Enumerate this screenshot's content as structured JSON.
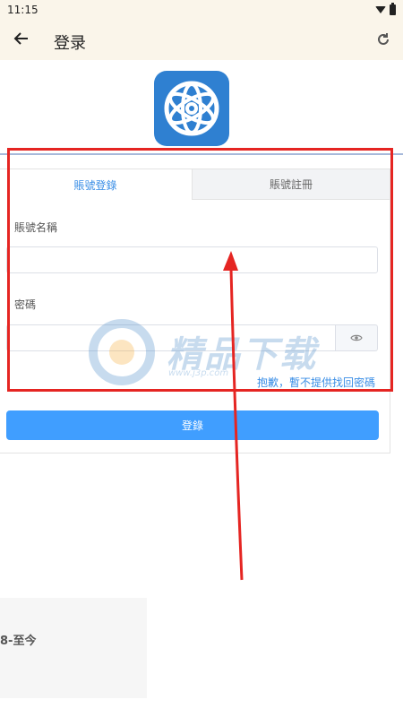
{
  "status_bar": {
    "time": "11:15",
    "wifi_icon": "wifi-icon",
    "battery_icon": "battery-icon"
  },
  "app_bar": {
    "title": "登录",
    "back_icon": "arrow-left-icon",
    "refresh_icon": "refresh-icon"
  },
  "logo": {
    "icon": "atom-logo-icon",
    "color": "#2f80d1"
  },
  "tabs": [
    {
      "label": "賬號登錄",
      "active": true
    },
    {
      "label": "賬號註冊",
      "active": false
    }
  ],
  "form": {
    "username_label": "賬號名稱",
    "username_value": "",
    "password_label": "密碼",
    "password_value": "",
    "eye_icon": "eye-icon",
    "forgot_text": "抱歉，暫不提供找回密碼",
    "submit_label": "登錄"
  },
  "watermark": {
    "text": "精品下载",
    "url": "www.j3p.com"
  },
  "bottom_card": {
    "text": "8-至今"
  },
  "colors": {
    "accent": "#409eff",
    "link": "#3a8ee6",
    "highlight": "#e52522",
    "app_bar_bg": "#faf5ea"
  }
}
